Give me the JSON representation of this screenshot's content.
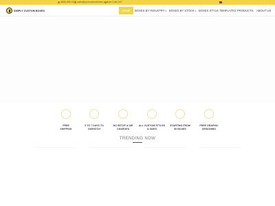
{
  "topbar": {
    "phone": "(888) 555-0199",
    "email": "sales@yourcustomboxes.com",
    "extra": "Live Chat 24/7"
  },
  "navbar": {
    "logo_text": "SIMPLY CUSTOM BOXES",
    "items": [
      {
        "label": "HOME",
        "active": true
      },
      {
        "label": "BOXES BY INDUSTRY",
        "dropdown": true
      },
      {
        "label": "BOXES BY STOCK",
        "dropdown": true
      },
      {
        "label": "BOXES STYLE TEMPLATES"
      },
      {
        "label": "PRODUCTS"
      },
      {
        "label": "ABOUT US"
      }
    ]
  },
  "features": [
    {
      "line1": "FREE",
      "line2": "SHIPPING"
    },
    {
      "line1": "5 TO 7 DAYS TO",
      "line2": "DISPATCH"
    },
    {
      "line1": "NO SETUP & DIE",
      "line2": "CHARGES"
    },
    {
      "line1": "ALL CUSTOM STYLES",
      "line2": "& SIZES"
    },
    {
      "line1": "STARTING FROM",
      "line2": "50 BOXES"
    },
    {
      "line1": "FREE GRAPHIC",
      "line2": "DESIGNING"
    }
  ],
  "trending": {
    "title": "TRENDING NOW"
  },
  "colors": {
    "accent": "#f3d347",
    "text": "#444444"
  }
}
